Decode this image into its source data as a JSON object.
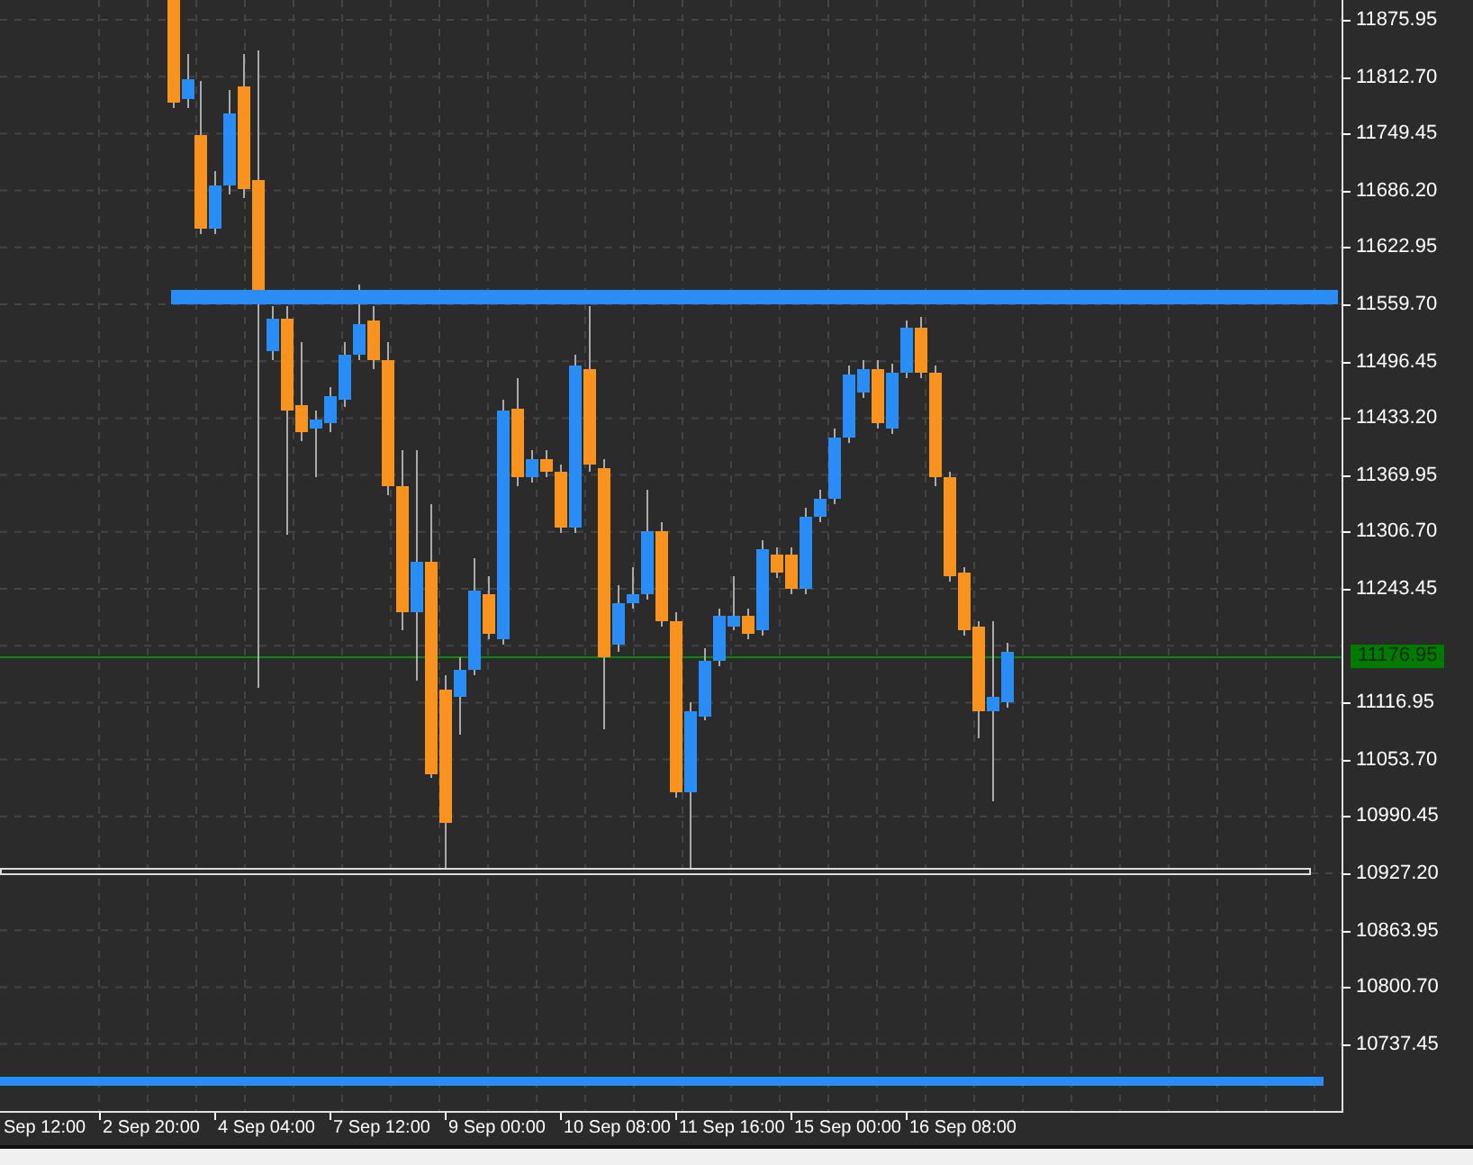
{
  "price_axis": {
    "labels": [
      "11875.95",
      "11812.70",
      "11749.45",
      "11686.20",
      "11622.95",
      "11559.70",
      "11496.45",
      "11433.20",
      "11369.95",
      "11306.70",
      "11243.45",
      "11116.95",
      "11053.70",
      "10990.45",
      "10927.20",
      "10863.95",
      "10800.70",
      "10737.45"
    ],
    "current_price": "11176.95"
  },
  "time_axis": {
    "labels": [
      "Sep 12:00",
      "2 Sep 20:00",
      "4 Sep 04:00",
      "7 Sep 12:00",
      "9 Sep 00:00",
      "10 Sep 08:00",
      "11 Sep 16:00",
      "15 Sep 00:00",
      "16 Sep 08:00"
    ]
  }
}
